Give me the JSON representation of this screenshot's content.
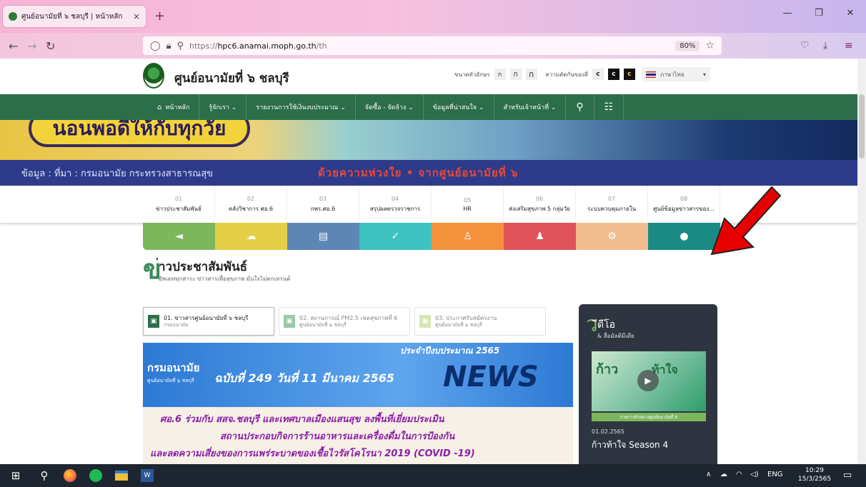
{
  "browser": {
    "tab_title": "ศูนย์อนามัยที่ ๖ ชลบุรี | หน้าหลัก",
    "tab_close": "×",
    "new_tab": "+",
    "url_scheme": "https://",
    "url_domain": "hpc6.anamai.moph.go.th",
    "url_path": "/th",
    "zoom": "80%",
    "icons": [
      "back-icon",
      "forward-icon",
      "reload-icon",
      "shield-icon",
      "lock-icon",
      "permissions-icon",
      "bookmark-star-icon",
      "pocket-icon",
      "download-icon",
      "extensions-icon"
    ]
  },
  "site": {
    "title": "ศูนย์อนามัยที่ ๖ ชลบุรี",
    "font_size_label": "ขนาดตัวอักษร",
    "font_sizes": [
      "ก",
      "ก",
      "ก"
    ],
    "contrast_label": "ความตัดกันของสี",
    "contrast_options": [
      "c",
      "c",
      "c"
    ],
    "language": "ภาษาไทย"
  },
  "menu": {
    "items": [
      "หน้าหลัก",
      "รู้จักเรา ⌄",
      "รายงานการใช้เงินงบประมาณ ⌄",
      "จัดซื้อ - จัดจ้าง ⌄",
      "ข้อมูลที่น่าสนใจ ⌄",
      "สำหรับเจ้าหน้าที่ ⌄"
    ],
    "home_icon": "home-icon",
    "search_icon": "search-icon",
    "sitemap_icon": "sitemap-icon"
  },
  "banner": {
    "headline": "นอนพอดีให้กับทุกวัย",
    "source": "ข้อมูล : ที่มา : กรมอนามัย  กระทรวงสาธารณสุข",
    "slogan": "ด้วยความห่วงใย • จากศูนย์อนามัยที่ ๖"
  },
  "quicklinks": [
    {
      "num": "01",
      "label": "ข่าวประชาสัมพันธ์"
    },
    {
      "num": "02",
      "label": "คลังวิชาการ ศอ.6"
    },
    {
      "num": "03",
      "label": "กพร.ศอ.6"
    },
    {
      "num": "04",
      "label": "สรุปผลตรวจราชการ"
    },
    {
      "num": "05",
      "label": "HR"
    },
    {
      "num": "06",
      "label": "ส่งเสริมสุขภาพ 5 กลุ่มวัย"
    },
    {
      "num": "07",
      "label": "ระบบควบคุมภายใน"
    },
    {
      "num": "08",
      "label": "ศูนย์ข้อมูลข่าวสารของ..."
    }
  ],
  "color_icons": [
    {
      "icon": "megaphone-icon",
      "glyph": "◄",
      "color": "#7cb75e"
    },
    {
      "icon": "cloud-download-icon",
      "glyph": "☁",
      "color": "#e4cf47"
    },
    {
      "icon": "book-icon",
      "glyph": "▤",
      "color": "#5e86b5"
    },
    {
      "icon": "checklist-icon",
      "glyph": "✓",
      "color": "#3ec3c0"
    },
    {
      "icon": "person-icon",
      "glyph": "♙",
      "color": "#f4913c"
    },
    {
      "icon": "person-wave-icon",
      "glyph": "♟",
      "color": "#e0535a"
    },
    {
      "icon": "gear-icon",
      "glyph": "⚙",
      "color": "#f2bd8e"
    },
    {
      "icon": "lightbulb-icon",
      "glyph": "●",
      "color": "#1a8a85"
    }
  ],
  "news": {
    "big_letter": "ข",
    "title": "่าวประชาสัมพันธ์",
    "subtitle": "อัพเดททุกสาระ ข่าวสารเพื่อสุขภาพ มั่นใจไม่ตกเทรนด์",
    "tabs": [
      {
        "line1": "01. ข่าวสารศูนย์อนามัยที่ ๖ ชลบุรี",
        "line2": "กรมอนามัย",
        "active": true
      },
      {
        "line1": "02. สถานการณ์ PM2.5 เขตสุขภาพที่ 6",
        "line2": "ศูนย์อนามัยที่ ๖ ชลบุรี",
        "active": false
      },
      {
        "line1": "03. ประกาศรับสมัครงาน",
        "line2": "ศูนย์อนามัยที่ ๖ ชลบุรี",
        "active": false
      }
    ],
    "image": {
      "year": "ประจำปีงบประมาณ 2565",
      "dept": "กรมอนามัย",
      "dept_sub": "ศูนย์อนามัยที่ ๖ ชลบุรี",
      "issue": "ฉบับที่ 249 วันที่ 11 มีนาคม 2565",
      "word": "NEWS",
      "line1": "ศอ.6 ร่วมกับ สสจ.ชลบุรี และเทศบาลเมืองแสนสุข ลงพื้นที่เยี่ยมประเมิน",
      "line2": "สถานประกอบกิจการร้านอาหารและเครื่องดื่มในการป้องกัน",
      "line3": "และลดความเสี่ยงของการแพร่ระบาดของเชื้อไวรัสโคโรนา 2019 (COVID -19)"
    }
  },
  "video": {
    "big_letter": "ว",
    "title": "ีดีโอ",
    "subtitle": "& สื่อมัลติมีเดีย",
    "thumb_text1": "ก้าว",
    "thumb_text2": "ท้าใจ",
    "tag": "รายการตัวอย่างศูนย์อนามัยที่ 6",
    "date": "01.02.2565",
    "name": "ก้าวท้าใจ Season 4"
  },
  "taskbar": {
    "lang": "ENG",
    "time": "10:29",
    "date": "15/3/2565"
  }
}
